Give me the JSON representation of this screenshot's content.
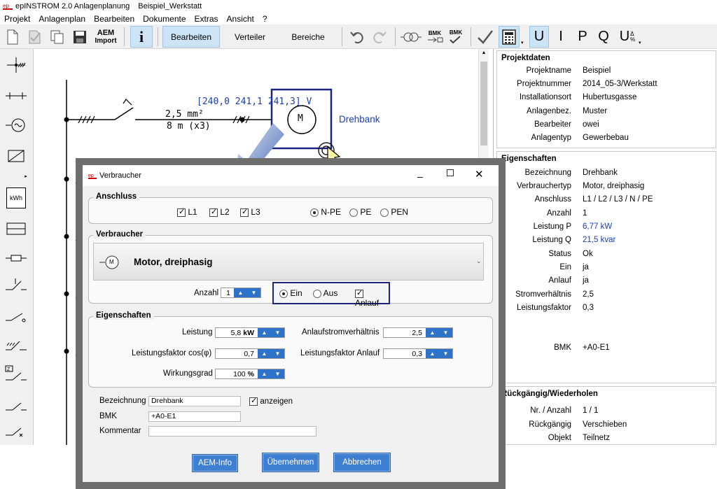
{
  "window": {
    "app_title": "epINSTROM 2.0 Anlagenplanung",
    "doc_title": "Beispiel_Werkstatt"
  },
  "menu": [
    "Projekt",
    "Anlagenplan",
    "Bearbeiten",
    "Dokumente",
    "Extras",
    "Ansicht",
    "?"
  ],
  "toolbar": {
    "aem_label_1": "AEM",
    "aem_label_2": "Import",
    "info": "i",
    "tabs": [
      "Bearbeiten",
      "Verteiler",
      "Bereiche"
    ],
    "bmk1": "BMK",
    "bmk2": "BMK",
    "U": "U",
    "I": "I",
    "P": "P",
    "Q": "Q",
    "Udelta": "U",
    "udelta_sup": "Δ",
    "udelta_sub": "%"
  },
  "leftbar": {
    "kwh": "kWh"
  },
  "canvas": {
    "cable_section": "2,5 mm²",
    "cable_length": "8 m (x3)",
    "voltage_label": "[240,0 241,1 241,3] V",
    "motor_symbol": "M",
    "motor_name": "Drehbank"
  },
  "projektdaten": {
    "title": "Projektdaten",
    "rows": [
      {
        "k": "Projektname",
        "v": "Beispiel"
      },
      {
        "k": "Projektnummer",
        "v": "2014_05-3/Werkstatt"
      },
      {
        "k": "Installationsort",
        "v": "Hubertusgasse"
      },
      {
        "k": "Anlagenbez.",
        "v": "Muster"
      },
      {
        "k": "Bearbeiter",
        "v": "owei"
      },
      {
        "k": "Anlagentyp",
        "v": "Gewerbebau"
      }
    ]
  },
  "eigenschaften_panel": {
    "title": "Eigenschaften",
    "rows": [
      {
        "k": "Bezeichnung",
        "v": "Drehbank"
      },
      {
        "k": "Verbrauchertyp",
        "v": "Motor, dreiphasig"
      },
      {
        "k": "Anschluss",
        "v": "L1 / L2 / L3 / N / PE"
      },
      {
        "k": "Anzahl",
        "v": "1"
      },
      {
        "k": "Leistung P",
        "v": "6,77 kW"
      },
      {
        "k": "Leistung Q",
        "v": "21,5 kvar"
      },
      {
        "k": "Status",
        "v": "Ok"
      },
      {
        "k": "Ein",
        "v": "ja"
      },
      {
        "k": "Anlauf",
        "v": "ja"
      },
      {
        "k": "Stromverhältnis",
        "v": "2,5"
      },
      {
        "k": "Leistungsfaktor",
        "v": "0,3"
      }
    ],
    "bmk_k": "BMK",
    "bmk_v": "+A0-E1"
  },
  "undo_panel": {
    "title": "Rückgängig/Wiederholen",
    "rows": [
      {
        "k": "Nr. / Anzahl",
        "v": "1 / 1"
      },
      {
        "k": "Rückgängig",
        "v": "Verschieben"
      },
      {
        "k": "Objekt",
        "v": "Teilnetz"
      }
    ]
  },
  "dialog": {
    "title": "Verbraucher",
    "anschluss": {
      "label": "Anschluss",
      "l1": "L1",
      "l2": "L2",
      "l3": "L3",
      "npe": "N-PE",
      "pe": "PE",
      "pen": "PEN"
    },
    "verbraucher": {
      "label": "Verbraucher",
      "type": "Motor, dreiphasig",
      "symbol": "M",
      "anzahl_label": "Anzahl",
      "anzahl_value": "1",
      "ein": "Ein",
      "aus": "Aus",
      "anlauf": "Anlauf"
    },
    "eigenschaften": {
      "label": "Eigenschaften",
      "leistung_label": "Leistung",
      "leistung_value": "5,8",
      "leistung_unit": "kW",
      "cosphi_label": "Leistungsfaktor cos(φ)",
      "cosphi_value": "0,7",
      "wirkungsgrad_label": "Wirkungsgrad",
      "wirkungsgrad_value": "100",
      "wirkungsgrad_unit": "%",
      "anlaufstrom_label": "Anlaufstromverhältnis",
      "anlaufstrom_value": "2,5",
      "lf_anlauf_label": "Leistungsfaktor Anlauf",
      "lf_anlauf_value": "0,3"
    },
    "bezeichnung_label": "Bezeichnung",
    "bezeichnung_value": "Drehbank",
    "anzeigen_label": "anzeigen",
    "bmk_label": "BMK",
    "bmk_value": "+A0-E1",
    "kommentar_label": "Kommentar",
    "kommentar_value": "",
    "buttons": {
      "aem_info": "AEM-Info",
      "uebernehmen": "Übernehmen",
      "abbrechen": "Abbrechen"
    }
  },
  "colors": {
    "accent": "#2c73c9",
    "highlight_box": "#1a237e",
    "link_blue": "#1a3fb0"
  }
}
